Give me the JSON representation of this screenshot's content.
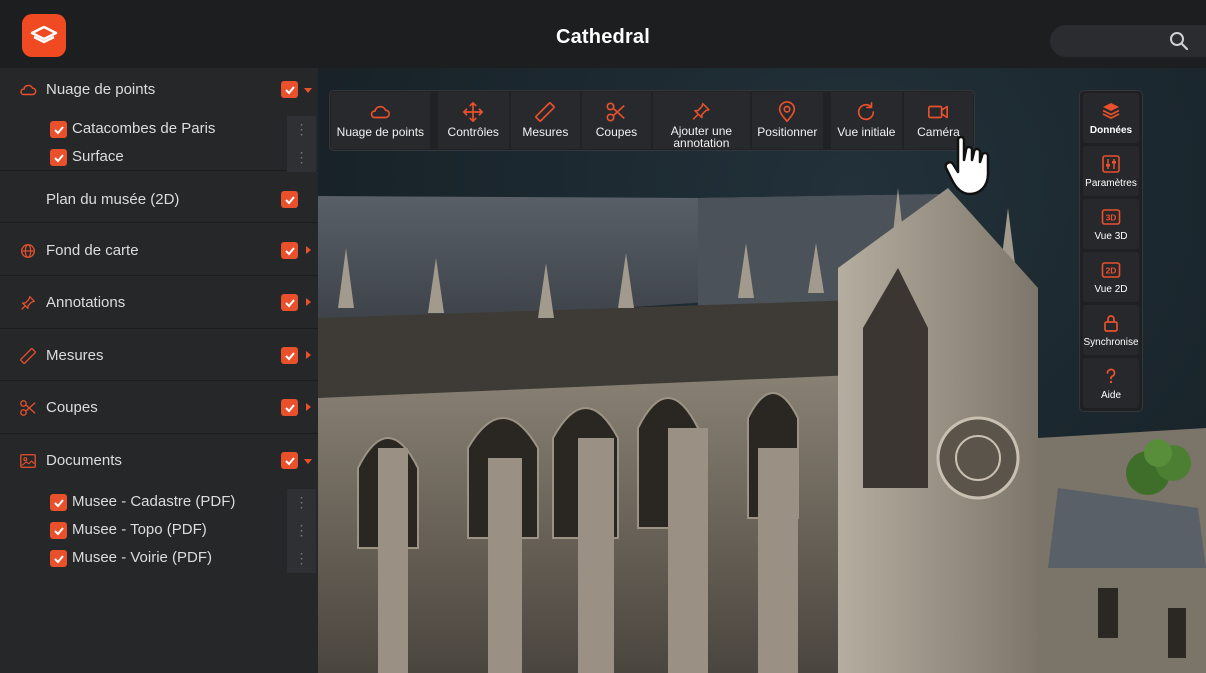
{
  "app": {
    "title": "Cathedral"
  },
  "search": {
    "placeholder": ""
  },
  "sidebar": {
    "sections": [
      {
        "label": "Nuage de points",
        "icon": "cloud-icon",
        "expanded": true,
        "children": [
          {
            "label": "Catacombes de Paris"
          },
          {
            "label": "Surface"
          }
        ]
      },
      {
        "label": "Plan du musée (2D)"
      },
      {
        "label": "Fond de carte",
        "icon": "globe-icon"
      },
      {
        "label": "Annotations",
        "icon": "pin-icon"
      },
      {
        "label": "Mesures",
        "icon": "ruler-icon"
      },
      {
        "label": "Coupes",
        "icon": "scissors-icon"
      },
      {
        "label": "Documents",
        "icon": "image-icon",
        "expanded": true,
        "children": [
          {
            "label": "Musee - Cadastre (PDF)"
          },
          {
            "label": "Musee - Topo (PDF)"
          },
          {
            "label": "Musee - Voirie (PDF)"
          }
        ]
      }
    ]
  },
  "toolbar": {
    "items": [
      {
        "label": "Nuage de points",
        "icon": "cloud-icon"
      },
      {
        "label": "Contrôles",
        "icon": "move-icon"
      },
      {
        "label": "Mesures",
        "icon": "ruler-icon"
      },
      {
        "label": "Coupes",
        "icon": "scissors-icon"
      },
      {
        "label_line1": "Ajouter une",
        "label_line2": "annotation",
        "icon": "pin-icon"
      },
      {
        "label": "Positionner",
        "icon": "location-icon"
      },
      {
        "label": "Vue initiale",
        "icon": "refresh-icon"
      },
      {
        "label": "Caméra",
        "icon": "camera-icon"
      }
    ]
  },
  "right_panel": {
    "items": [
      {
        "label": "Données",
        "icon": "layers-icon"
      },
      {
        "label": "Paramètres",
        "icon": "sliders-icon"
      },
      {
        "label": "Vue 3D",
        "icon": "3d-icon"
      },
      {
        "label": "Vue 2D",
        "icon": "2d-icon"
      },
      {
        "label": "Synchronise",
        "icon": "lock-icon"
      },
      {
        "label": "Aide",
        "icon": "help-icon"
      }
    ]
  },
  "colors": {
    "accent": "#e8512c",
    "logo": "#f04a23",
    "header_bg": "#1d1e20",
    "sidebar_bg": "#262729"
  }
}
